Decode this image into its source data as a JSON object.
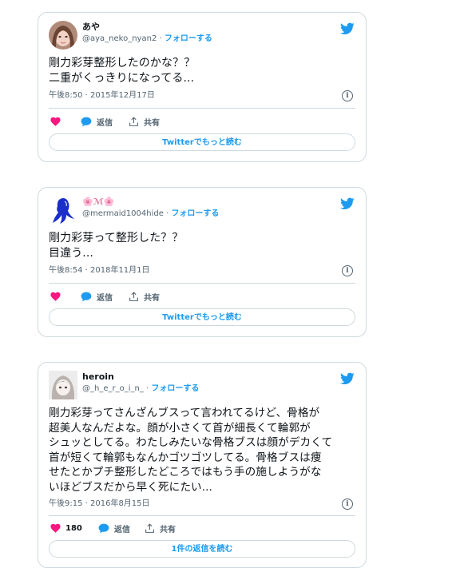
{
  "follow_label": "フォローする",
  "share_label": "共有",
  "reply_label": "返信",
  "info_glyph": "i",
  "colors": {
    "accent": "#1d9bf0",
    "heart": "#f91880",
    "border": "#cfd9de",
    "secondary": "#536471"
  },
  "tweets": [
    {
      "name": "あや",
      "handle": "@aya_neko_nyan2 ·",
      "text": "剛力彩芽整形したのかな？？\n二重がくっきりになってる...",
      "meta": "午後8:50 · 2015年12月17日",
      "like_count": "",
      "readmore": "Twitterでもっと読む"
    },
    {
      "name": "🌸ℳ🌸",
      "handle": "@mermaid1004hide ·",
      "text": "剛力彩芽って整形した？？\n目違う...",
      "meta": "午後8:54 · 2018年11月1日",
      "like_count": "",
      "readmore": "Twitterでもっと読む"
    },
    {
      "name": "heroin",
      "handle": "@_h_e_r_o_i_n_ ·",
      "text": "剛力彩芽ってさんざんブスって言われてるけど、骨格が\n超美人なんだよな。顔が小さくて首が細長くて輪郭が\nシュッとしてる。わたしみたいな骨格ブスは顔がデカくて\n首が短くて輪郭もなんかゴツゴツしてる。骨格ブスは痩\nせたとかプチ整形したどころではもう手の施しようがな\nいほどブスだから早く死にたい...",
      "meta": "午後9:15 · 2016年8月15日",
      "like_count": "180",
      "readmore": "1件の返信を読む"
    }
  ]
}
